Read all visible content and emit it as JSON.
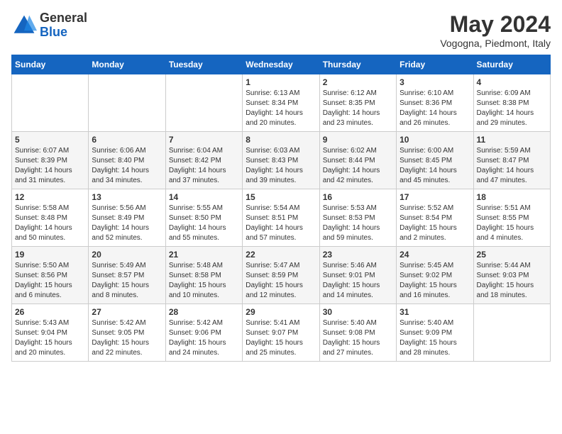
{
  "logo": {
    "general": "General",
    "blue": "Blue"
  },
  "title": "May 2024",
  "subtitle": "Vogogna, Piedmont, Italy",
  "days_of_week": [
    "Sunday",
    "Monday",
    "Tuesday",
    "Wednesday",
    "Thursday",
    "Friday",
    "Saturday"
  ],
  "weeks": [
    [
      {
        "day": "",
        "info": ""
      },
      {
        "day": "",
        "info": ""
      },
      {
        "day": "",
        "info": ""
      },
      {
        "day": "1",
        "info": "Sunrise: 6:13 AM\nSunset: 8:34 PM\nDaylight: 14 hours and 20 minutes."
      },
      {
        "day": "2",
        "info": "Sunrise: 6:12 AM\nSunset: 8:35 PM\nDaylight: 14 hours and 23 minutes."
      },
      {
        "day": "3",
        "info": "Sunrise: 6:10 AM\nSunset: 8:36 PM\nDaylight: 14 hours and 26 minutes."
      },
      {
        "day": "4",
        "info": "Sunrise: 6:09 AM\nSunset: 8:38 PM\nDaylight: 14 hours and 29 minutes."
      }
    ],
    [
      {
        "day": "5",
        "info": "Sunrise: 6:07 AM\nSunset: 8:39 PM\nDaylight: 14 hours and 31 minutes."
      },
      {
        "day": "6",
        "info": "Sunrise: 6:06 AM\nSunset: 8:40 PM\nDaylight: 14 hours and 34 minutes."
      },
      {
        "day": "7",
        "info": "Sunrise: 6:04 AM\nSunset: 8:42 PM\nDaylight: 14 hours and 37 minutes."
      },
      {
        "day": "8",
        "info": "Sunrise: 6:03 AM\nSunset: 8:43 PM\nDaylight: 14 hours and 39 minutes."
      },
      {
        "day": "9",
        "info": "Sunrise: 6:02 AM\nSunset: 8:44 PM\nDaylight: 14 hours and 42 minutes."
      },
      {
        "day": "10",
        "info": "Sunrise: 6:00 AM\nSunset: 8:45 PM\nDaylight: 14 hours and 45 minutes."
      },
      {
        "day": "11",
        "info": "Sunrise: 5:59 AM\nSunset: 8:47 PM\nDaylight: 14 hours and 47 minutes."
      }
    ],
    [
      {
        "day": "12",
        "info": "Sunrise: 5:58 AM\nSunset: 8:48 PM\nDaylight: 14 hours and 50 minutes."
      },
      {
        "day": "13",
        "info": "Sunrise: 5:56 AM\nSunset: 8:49 PM\nDaylight: 14 hours and 52 minutes."
      },
      {
        "day": "14",
        "info": "Sunrise: 5:55 AM\nSunset: 8:50 PM\nDaylight: 14 hours and 55 minutes."
      },
      {
        "day": "15",
        "info": "Sunrise: 5:54 AM\nSunset: 8:51 PM\nDaylight: 14 hours and 57 minutes."
      },
      {
        "day": "16",
        "info": "Sunrise: 5:53 AM\nSunset: 8:53 PM\nDaylight: 14 hours and 59 minutes."
      },
      {
        "day": "17",
        "info": "Sunrise: 5:52 AM\nSunset: 8:54 PM\nDaylight: 15 hours and 2 minutes."
      },
      {
        "day": "18",
        "info": "Sunrise: 5:51 AM\nSunset: 8:55 PM\nDaylight: 15 hours and 4 minutes."
      }
    ],
    [
      {
        "day": "19",
        "info": "Sunrise: 5:50 AM\nSunset: 8:56 PM\nDaylight: 15 hours and 6 minutes."
      },
      {
        "day": "20",
        "info": "Sunrise: 5:49 AM\nSunset: 8:57 PM\nDaylight: 15 hours and 8 minutes."
      },
      {
        "day": "21",
        "info": "Sunrise: 5:48 AM\nSunset: 8:58 PM\nDaylight: 15 hours and 10 minutes."
      },
      {
        "day": "22",
        "info": "Sunrise: 5:47 AM\nSunset: 8:59 PM\nDaylight: 15 hours and 12 minutes."
      },
      {
        "day": "23",
        "info": "Sunrise: 5:46 AM\nSunset: 9:01 PM\nDaylight: 15 hours and 14 minutes."
      },
      {
        "day": "24",
        "info": "Sunrise: 5:45 AM\nSunset: 9:02 PM\nDaylight: 15 hours and 16 minutes."
      },
      {
        "day": "25",
        "info": "Sunrise: 5:44 AM\nSunset: 9:03 PM\nDaylight: 15 hours and 18 minutes."
      }
    ],
    [
      {
        "day": "26",
        "info": "Sunrise: 5:43 AM\nSunset: 9:04 PM\nDaylight: 15 hours and 20 minutes."
      },
      {
        "day": "27",
        "info": "Sunrise: 5:42 AM\nSunset: 9:05 PM\nDaylight: 15 hours and 22 minutes."
      },
      {
        "day": "28",
        "info": "Sunrise: 5:42 AM\nSunset: 9:06 PM\nDaylight: 15 hours and 24 minutes."
      },
      {
        "day": "29",
        "info": "Sunrise: 5:41 AM\nSunset: 9:07 PM\nDaylight: 15 hours and 25 minutes."
      },
      {
        "day": "30",
        "info": "Sunrise: 5:40 AM\nSunset: 9:08 PM\nDaylight: 15 hours and 27 minutes."
      },
      {
        "day": "31",
        "info": "Sunrise: 5:40 AM\nSunset: 9:09 PM\nDaylight: 15 hours and 28 minutes."
      },
      {
        "day": "",
        "info": ""
      }
    ]
  ]
}
